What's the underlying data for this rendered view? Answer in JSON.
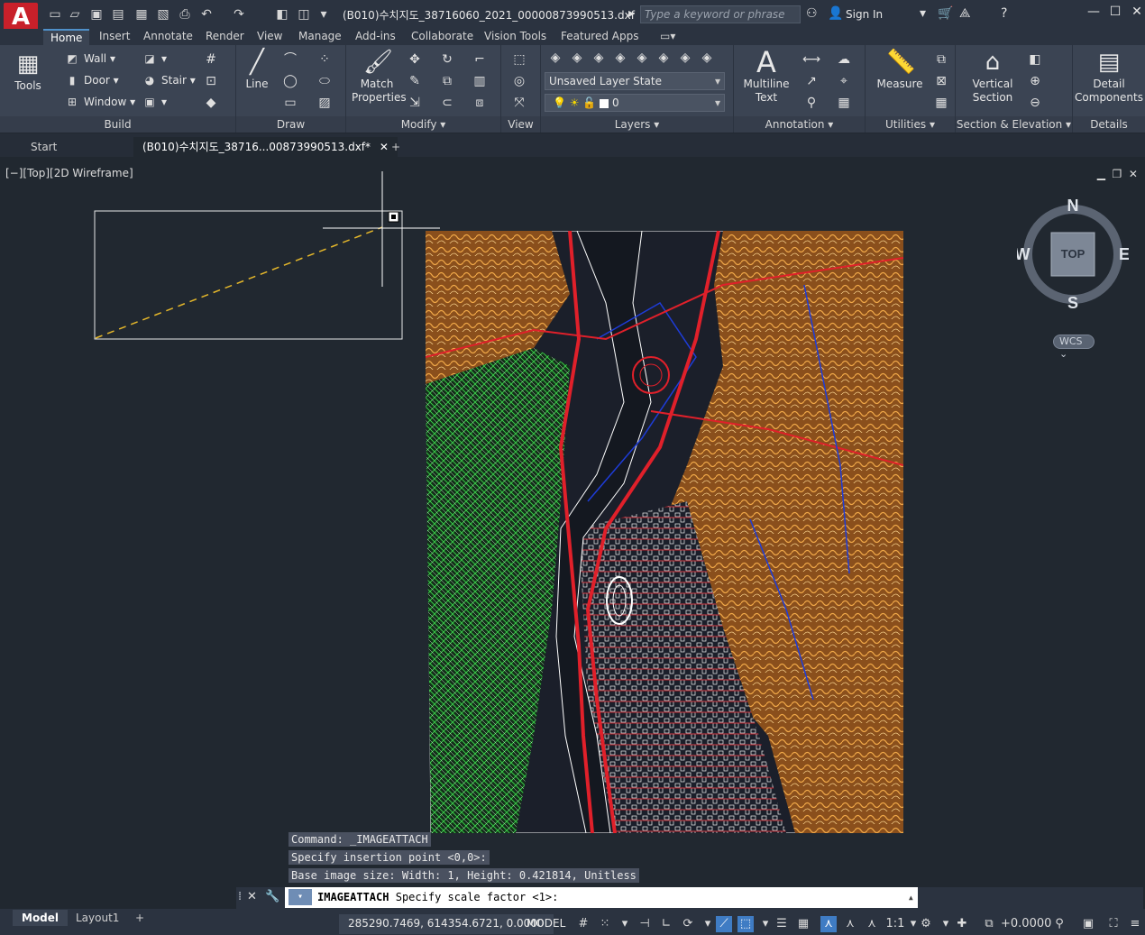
{
  "titlebar": {
    "app_letter": "A",
    "app_sub": "A",
    "document_title": "(B010)수치지도_38716060_2021_00000873990513.dxf",
    "search_placeholder": "Type a keyword or phrase",
    "sign_in": "Sign In"
  },
  "ribbon_tabs": [
    "Home",
    "Insert",
    "Annotate",
    "Render",
    "View",
    "Manage",
    "Add-ins",
    "Collaborate",
    "Vision Tools",
    "Featured Apps"
  ],
  "ribbon": {
    "build": {
      "label": "Build",
      "tools": "Tools",
      "wall": "Wall",
      "door": "Door",
      "window": "Window",
      "stair": "Stair"
    },
    "draw": {
      "label": "Draw",
      "line": "Line"
    },
    "modify": {
      "label": "Modify",
      "match_properties": "Match Properties"
    },
    "view": {
      "label": "View"
    },
    "layers": {
      "label": "Layers",
      "layer_state": "Unsaved Layer State",
      "current_layer": "0"
    },
    "annotation": {
      "label": "Annotation",
      "multiline_text": "Multiline Text"
    },
    "utilities": {
      "label": "Utilities",
      "measure": "Measure"
    },
    "section": {
      "label": "Section & Elevation",
      "vertical_section": "Vertical Section"
    },
    "details": {
      "label": "Details",
      "detail_components": "Detail Components"
    }
  },
  "doc_tabs": {
    "start": "Start",
    "active": "(B010)수치지도_38716...00873990513.dxf*"
  },
  "viewport": {
    "label": "[−][Top][2D Wireframe]",
    "viewcube": {
      "n": "N",
      "s": "S",
      "e": "E",
      "w": "W",
      "face": "TOP"
    },
    "wcs": "WCS"
  },
  "command": {
    "history": [
      "Command: _IMAGEATTACH",
      "Specify insertion point <0,0>:",
      "Base image size: Width: 1, Height: 0.421814, Unitless"
    ],
    "current_cmd": "IMAGEATTACH",
    "current_prompt": "Specify scale factor <1>:"
  },
  "status": {
    "model_tab": "Model",
    "layout_tab": "Layout1",
    "coordinates": "285290.7469, 614354.6721, 0.0000",
    "mode": "MODEL",
    "scale": "1:1",
    "offset": "+0.0000"
  },
  "colors": {
    "accent": "#3f7cc4",
    "app_red": "#c8202a",
    "terrain_orange": "#c87a2a",
    "road_red": "#e0202a",
    "water_blue": "#1e3cd8",
    "vegetation_green": "#2cc83c"
  }
}
